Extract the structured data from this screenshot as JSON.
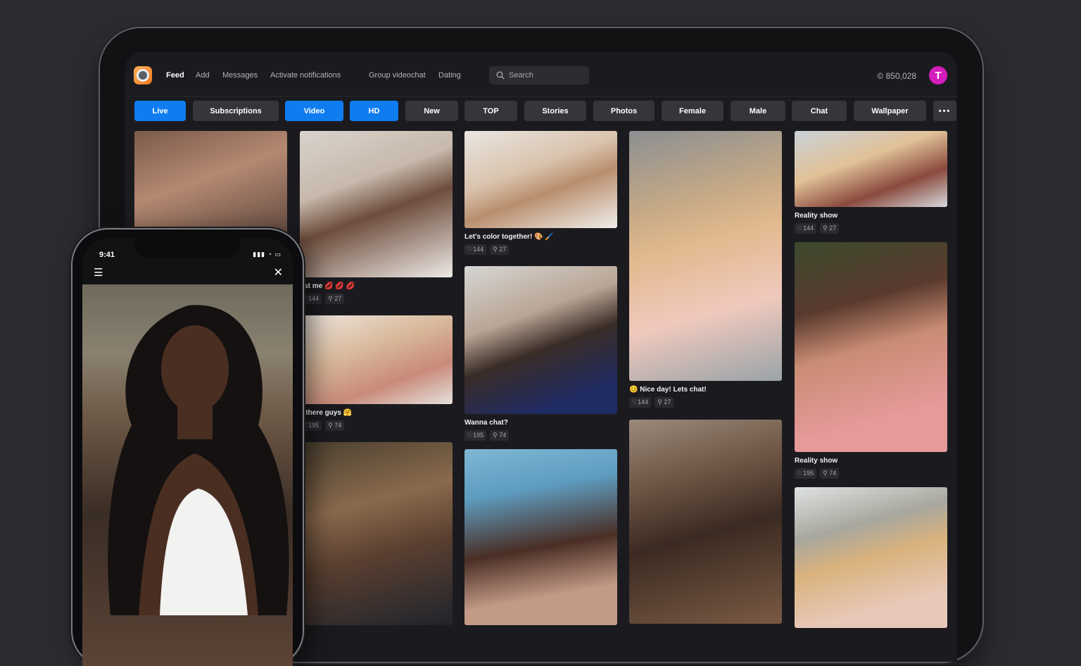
{
  "app": {
    "nav": [
      "Feed",
      "Add",
      "Messages",
      "Activate notifications",
      "Group videochat",
      "Dating"
    ],
    "search_placeholder": "Search",
    "coins": "850,028",
    "avatar_letter": "T"
  },
  "filters": [
    "Live",
    "Subscriptions",
    "Video",
    "HD",
    "New",
    "TOP",
    "Stories",
    "Photos",
    "Female",
    "Male",
    "Chat",
    "Wallpaper"
  ],
  "active_filters": [
    "Live",
    "Video",
    "HD"
  ],
  "more_icon": "ellipsis-icon",
  "cards": {
    "c2a": {
      "caption": "ust me 💋 💋 💋",
      "likes": "144",
      "viewers": "27"
    },
    "c2b": {
      "caption": "li there guys 🤗",
      "likes": "195",
      "viewers": "74"
    },
    "c3a": {
      "caption": "Let's color together! 🎨 🖌️",
      "likes": "144",
      "viewers": "27"
    },
    "c3b": {
      "caption": "Wanna chat?",
      "likes": "195",
      "viewers": "74"
    },
    "c4a": {
      "caption": "😊 Nice day! Lets chat!",
      "likes": "144",
      "viewers": "27"
    },
    "c5a": {
      "caption": "Reality show",
      "likes": "144",
      "viewers": "27"
    },
    "c5b": {
      "caption": "Reality show",
      "likes": "195",
      "viewers": "74"
    }
  },
  "phone": {
    "time": "9:41",
    "menu_icon": "hamburger-icon",
    "close_icon": "close-icon"
  },
  "colors": {
    "accent": "#0f7cf0",
    "avatar": "#d51dbd",
    "background": "#2b2c30"
  }
}
